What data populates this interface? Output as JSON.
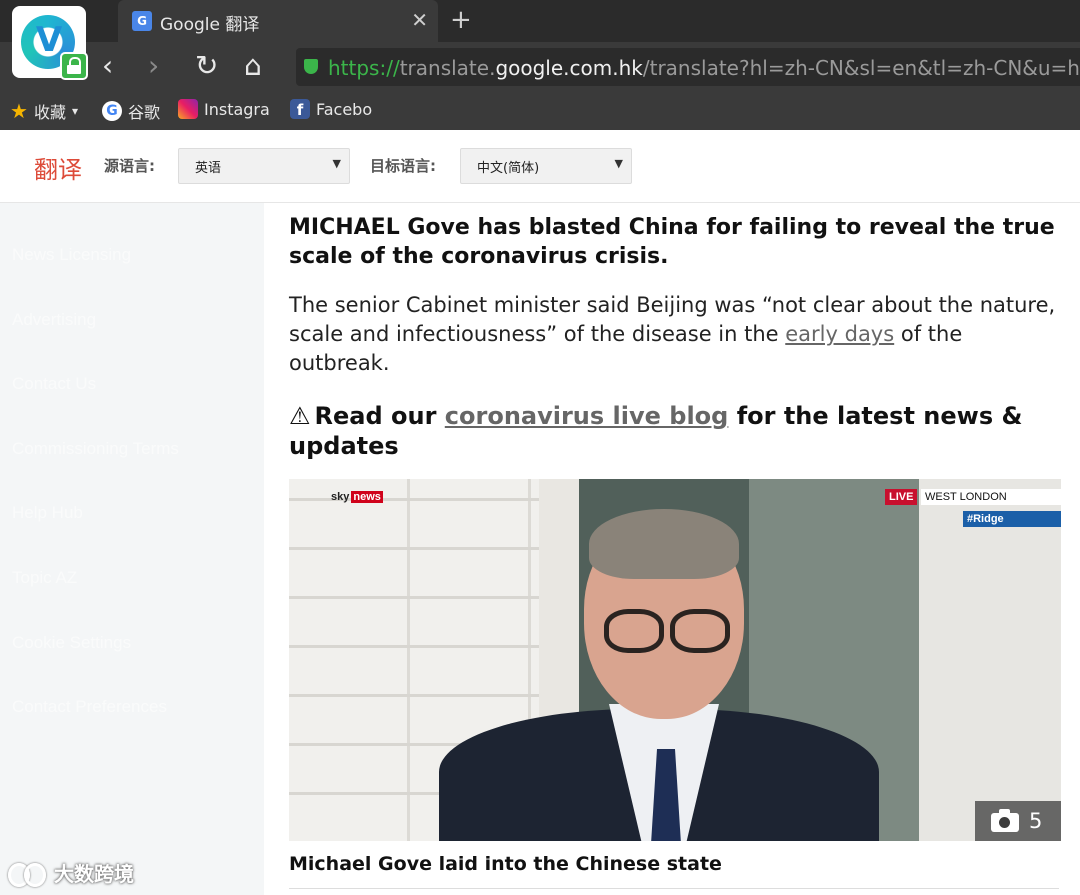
{
  "browser": {
    "tab": {
      "title": "Google 翻译",
      "favicon": "google-translate-icon"
    },
    "new_tab": "+",
    "close": "✕",
    "nav": {
      "back": "‹",
      "forward": "›",
      "reload": "↻",
      "home": "⌂"
    },
    "url": {
      "scheme": "https://",
      "pre_host": "translate.",
      "host": "google.com.hk",
      "rest": "/translate?hl=zh-CN&sl=en&tl=zh-CN&u=https%"
    },
    "bookmarks": [
      {
        "label": "收藏",
        "icon": "star-icon",
        "dropdown": "▾"
      },
      {
        "label": "谷歌",
        "icon": "google-icon"
      },
      {
        "label": "Instagra",
        "icon": "instagram-icon"
      },
      {
        "label": "Facebo",
        "icon": "facebook-icon"
      }
    ]
  },
  "translate": {
    "logo": "翻译",
    "source_label": "源语言:",
    "source_value": "英语",
    "target_label": "目标语言:",
    "target_value": "中文(简体)",
    "arrow": "▼"
  },
  "sidebar": {
    "items": [
      "News Licensing",
      "Advertising",
      "Contact Us",
      "Commissioning Terms",
      "Help Hub",
      "Topic AZ",
      "Cookie Settings",
      "Contact Preferences"
    ]
  },
  "article": {
    "headline": "MICHAEL Gove has blasted China for failing to reveal the true scale of the coronavirus crisis.",
    "para_1": "The senior Cabinet minister said Beijing was “not clear about the nature, scale and infectiousness” of the disease in the ",
    "para_link": "early days",
    "para_2": " of the outbreak.",
    "promo_icon": "⚠",
    "promo_1": "Read our ",
    "promo_link": "coronavirus live blog",
    "promo_2": " for the latest news & updates",
    "photo": {
      "sky_logo": "sky",
      "sky_news": "news",
      "live": "LIVE",
      "location": "WEST LONDON",
      "hashtag": "#Ridge",
      "gallery_count": "5"
    },
    "caption": "Michael Gove laid into the Chinese state"
  },
  "watermark": "大数跨境"
}
